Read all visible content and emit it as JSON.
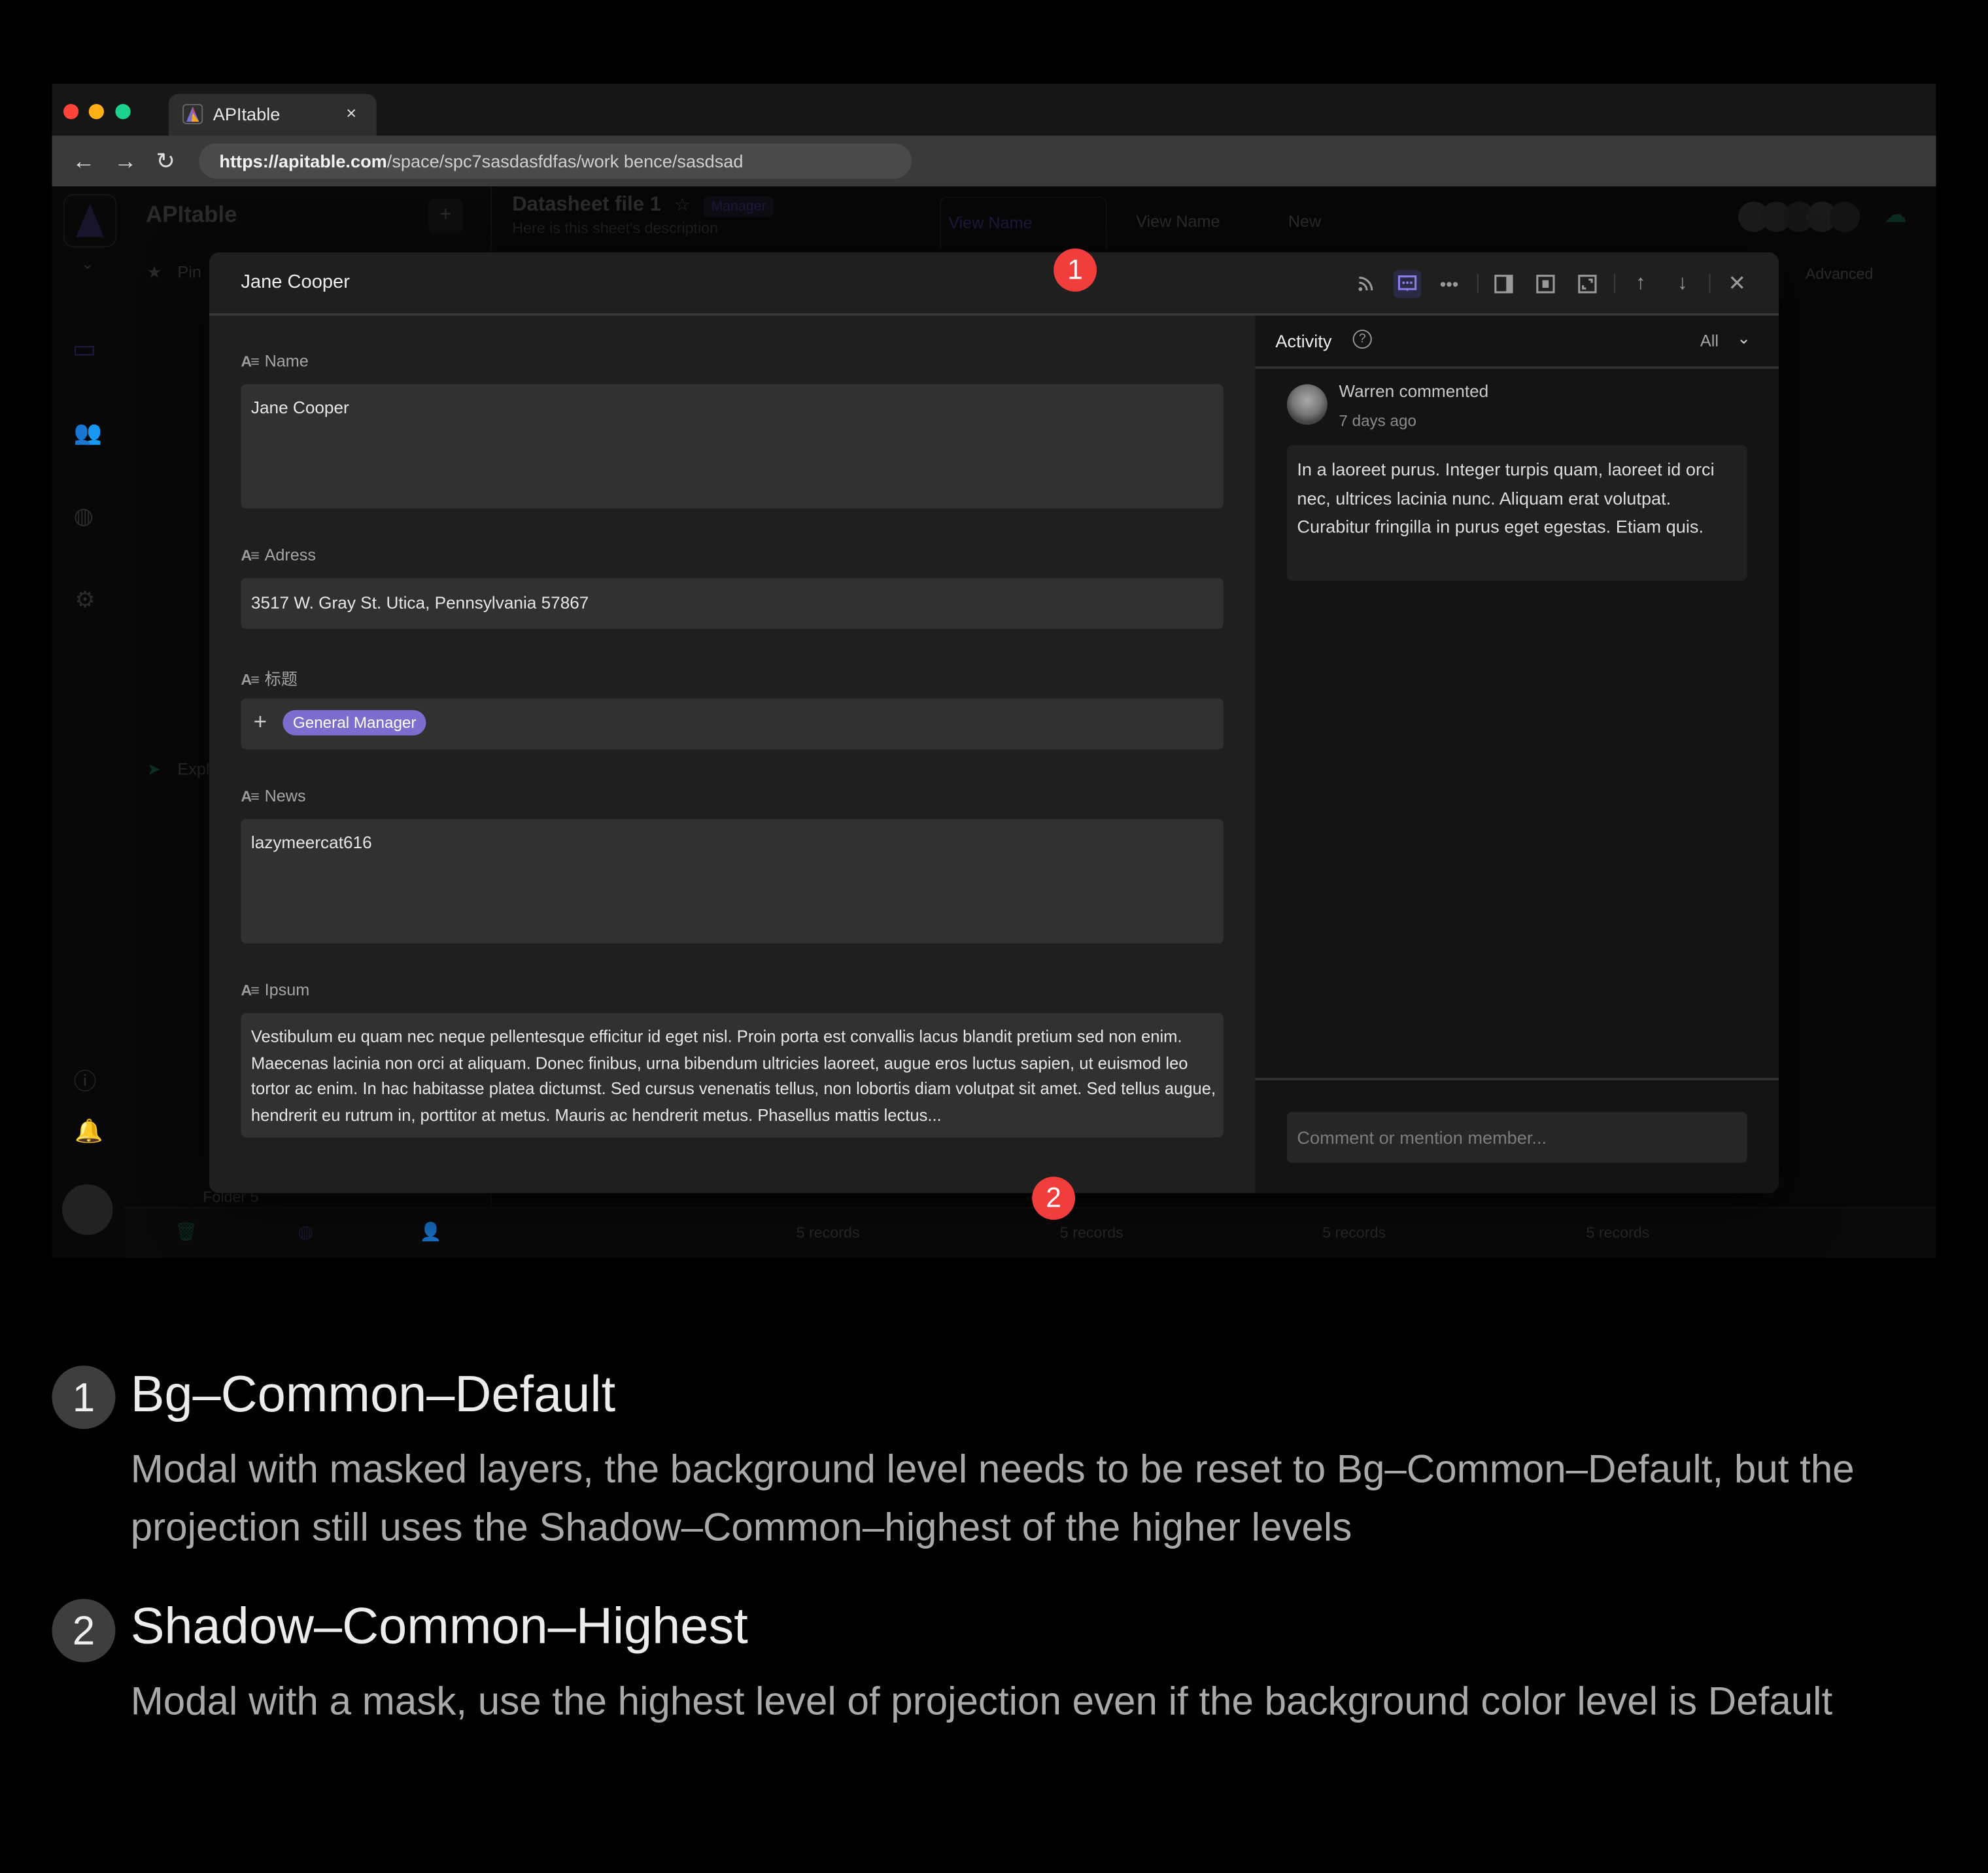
{
  "browser": {
    "tab_title": "APItable",
    "tab_close": "×",
    "url_host": "https://apitable.com",
    "url_path": "/space/spc7sasdasfdfas/work bence/sasdsad",
    "traffic_lights": {
      "close": "#ff453a",
      "minimize": "#ffb017",
      "maximize": "#1dd18e"
    }
  },
  "background_app": {
    "space_name": "APItable",
    "datasheet_title": "Datasheet file 1",
    "role_badge": "Manager",
    "description": "Here is this sheet's description",
    "views": [
      {
        "label": "View Name",
        "active": true
      },
      {
        "label": "View Name",
        "active": false
      }
    ],
    "new_view_label": "New",
    "advanced_label": "Advanced",
    "pin_label": "Pin",
    "explore_label": "Expl",
    "folder_label": "Folder 5",
    "record_counts": [
      "5 records",
      "5 records",
      "5 records",
      "5 records"
    ]
  },
  "modal": {
    "title": "Jane Cooper",
    "toolbar": [
      "subscribe-icon",
      "comment-icon",
      "more-icon",
      "side-panel-icon",
      "center-mode-icon",
      "fullscreen-icon",
      "previous-record-icon",
      "next-record-icon",
      "close-icon"
    ],
    "fields": [
      {
        "label": "Name",
        "value": "Jane Cooper"
      },
      {
        "label": "Adress",
        "value": "3517 W. Gray St. Utica, Pennsylvania 57867"
      },
      {
        "label": "标题",
        "value": "General Manager"
      },
      {
        "label": "News",
        "value": "lazymeercat616"
      },
      {
        "label": "Ipsum",
        "value": "Vestibulum eu quam nec neque pellentesque efficitur id eget nisl. Proin porta est convallis lacus blandit pretium sed non enim. Maecenas lacinia non orci at aliquam. Donec finibus, urna bibendum ultricies laoreet, augue eros luctus sapien, ut euismod leo tortor ac enim. In hac habitasse platea dictumst. Sed cursus venenatis tellus, non lobortis diam volutpat sit amet. Sed tellus augue, hendrerit eu rutrum in, porttitor at metus. Mauris ac hendrerit metus. Phasellus mattis lectus..."
      }
    ],
    "field_type_icon": "A≡",
    "add_option_label": "+",
    "tag_color": "#7b6ecf",
    "activity": {
      "title": "Activity",
      "filter": "All",
      "author_line": "Warren commented",
      "time": "7 days ago",
      "comment": "In a laoreet purus. Integer turpis quam, laoreet id orci nec, ultrices lacinia nunc. Aliquam erat volutpat. Curabitur fringilla in purus eget egestas. Etiam quis.",
      "comment_placeholder": "Comment or mention member..."
    }
  },
  "markers": [
    "1",
    "2"
  ],
  "annotations": [
    {
      "num": "1",
      "title": "Bg–Common–Default",
      "desc": "Modal with masked layers, the background level needs to be reset to Bg–Common–Default, but the projection still uses the Shadow–Common–highest of the higher levels"
    },
    {
      "num": "2",
      "title": "Shadow–Common–Highest",
      "desc": "Modal with a mask, use the highest level of projection even if the background color level is Default"
    }
  ]
}
